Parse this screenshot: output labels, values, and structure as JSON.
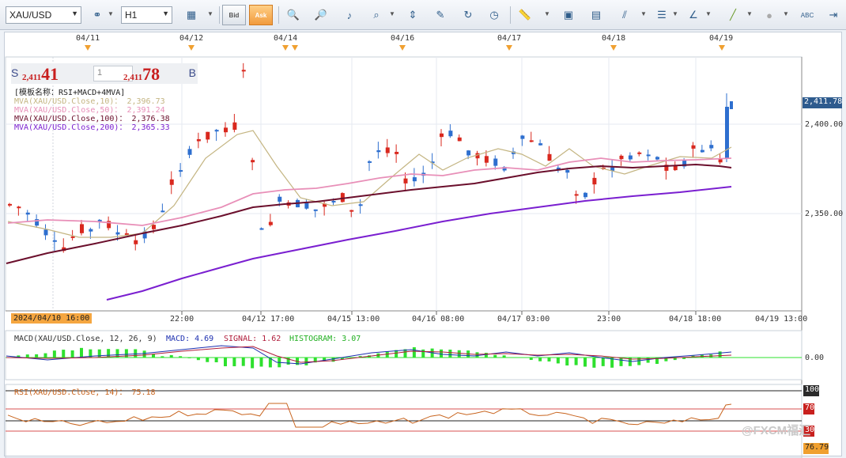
{
  "toolbar": {
    "symbol": "XAU/USD",
    "timeframe": "H1",
    "bid_label": "Bid",
    "ask_label": "Ask",
    "icons": [
      "link-icon",
      "chart-style-icon",
      "zoom-in-icon",
      "zoom-out-icon",
      "pan-icon",
      "zoom-range-icon",
      "fit-icon",
      "drawing-icon",
      "refresh-icon",
      "clock-icon",
      "ruler-icon",
      "image-icon",
      "window-icon",
      "fibonacci-icon",
      "lines-icon",
      "trend-icon",
      "pencil-icon",
      "ellipse-icon",
      "abc-icon",
      "scroll-icon"
    ]
  },
  "dates": [
    "04/11",
    "04/12",
    "04/14",
    "04/16",
    "04/17",
    "04/18",
    "04/19"
  ],
  "quote": {
    "sell_label": "S",
    "sell_prefix": "2,411",
    "sell_big": "41",
    "buy_prefix": "2,411",
    "buy_big": "78",
    "buy_label": "B",
    "quantity": "1"
  },
  "legend": {
    "template": "[模板名称：RSI+MACD+4MVA]",
    "ma10": "MVA(XAU/USD.Close,10)：  2,396.73",
    "ma50": "MVA(XAU/USD.Close,50)：  2,391.24",
    "ma100": "MVA(XAU/USD.Close,100)：  2,376.38",
    "ma200": "MVA(XAU/USD.Close,200)：  2,365.33"
  },
  "price_axis": {
    "last": "2,411.78",
    "ticks": [
      "2,400.00",
      "2,350.00"
    ]
  },
  "time_axis": {
    "start_badge": "2024/04/10 16:00",
    "labels": [
      "22:00",
      "04/12 17:00",
      "04/15 13:00",
      "04/16 08:00",
      "04/17 03:00",
      "23:00",
      "04/18 18:00",
      "04/19 13:00"
    ]
  },
  "macd": {
    "title": "MACD(XAU/USD.Close,  12,  26,  9)",
    "macd_value": "MACD:  4.69",
    "signal_value": "SIGNAL:  1.62",
    "histogram_value": "HISTOGRAM:  3.07",
    "zero_label": "0.00"
  },
  "rsi": {
    "title": "RSI(XAU/USD.Close,  14)：  75.18",
    "level_100": "100",
    "level_70": "70",
    "level_30": "30",
    "current": "76.79"
  },
  "watermark": "@FXCM福汇",
  "colors": {
    "up": "#2e6fcf",
    "down": "#d9281e",
    "ma10": "#c4b582",
    "ma50": "#e88fb8",
    "ma100": "#6b0f2c",
    "ma200": "#7a1fd0",
    "macd_line": "#1c2fb0",
    "signal_line": "#b01c3a",
    "histogram": "#2ee02e",
    "rsi_line": "#c8641e"
  }
}
